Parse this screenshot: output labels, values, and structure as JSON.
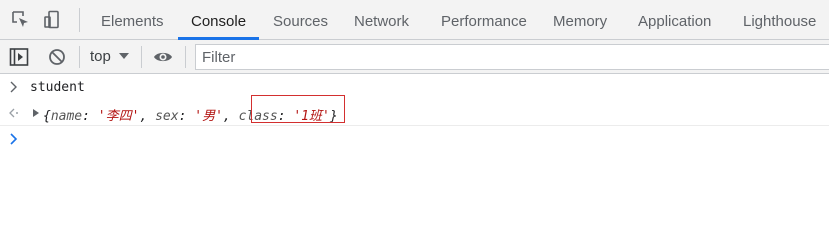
{
  "devtools": {
    "toolbar": {
      "inspect_icon": "cursor-select-icon",
      "device_icon": "device-toggle-icon"
    },
    "tabs": [
      {
        "label": "Elements",
        "active": false
      },
      {
        "label": "Console",
        "active": true
      },
      {
        "label": "Sources",
        "active": false
      },
      {
        "label": "Network",
        "active": false
      },
      {
        "label": "Performance",
        "active": false
      },
      {
        "label": "Memory",
        "active": false
      },
      {
        "label": "Application",
        "active": false
      },
      {
        "label": "Lighthouse",
        "active": false
      }
    ],
    "accent_color": "#1a73e8"
  },
  "console_toolbar": {
    "sidebar_icon": "sidebar-toggle-icon",
    "clear_icon": "clear-console-icon",
    "context": "top",
    "eye_icon": "live-expression-eye-icon",
    "filter_placeholder": "Filter"
  },
  "console": {
    "input": "student",
    "result": {
      "open_brace": "{",
      "entries": [
        {
          "key": "name",
          "value": "'李四'"
        },
        {
          "key": "sex",
          "value": "'男'"
        },
        {
          "key": "class",
          "value": "'1班'"
        }
      ],
      "close_brace": "}"
    },
    "highlight_color": "#d32f2f"
  }
}
